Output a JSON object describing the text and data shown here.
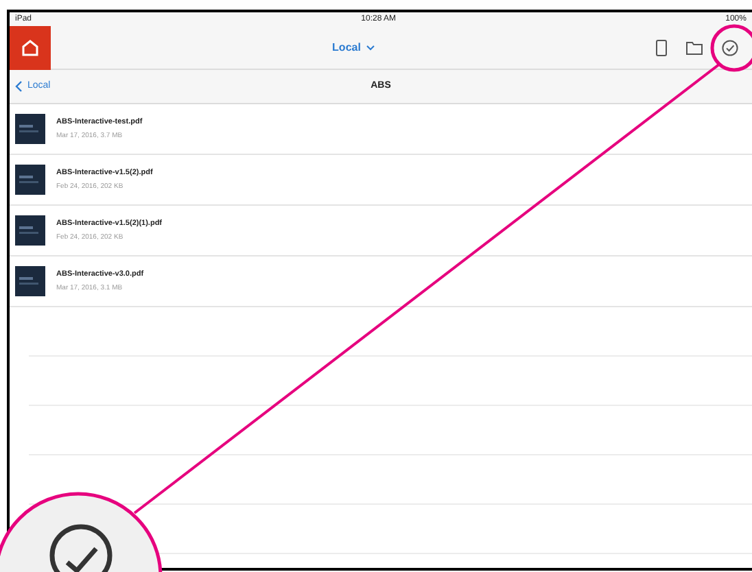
{
  "status_bar": {
    "carrier": "iPad",
    "time": "10:28 AM",
    "battery": "100%"
  },
  "nav_bar": {
    "title": "Local"
  },
  "sub_bar": {
    "back": "Local",
    "title": "ABS"
  },
  "files": [
    {
      "name": "ABS-Interactive-test.pdf",
      "meta": "Mar 17, 2016, 3.7 MB"
    },
    {
      "name": "ABS-Interactive-v1.5(2).pdf",
      "meta": "Feb 24, 2016, 202 KB"
    },
    {
      "name": "ABS-Interactive-v1.5(2)(1).pdf",
      "meta": "Feb 24, 2016, 202 KB"
    },
    {
      "name": "ABS-Interactive-v3.0.pdf",
      "meta": "Mar 17, 2016, 3.1 MB"
    }
  ]
}
